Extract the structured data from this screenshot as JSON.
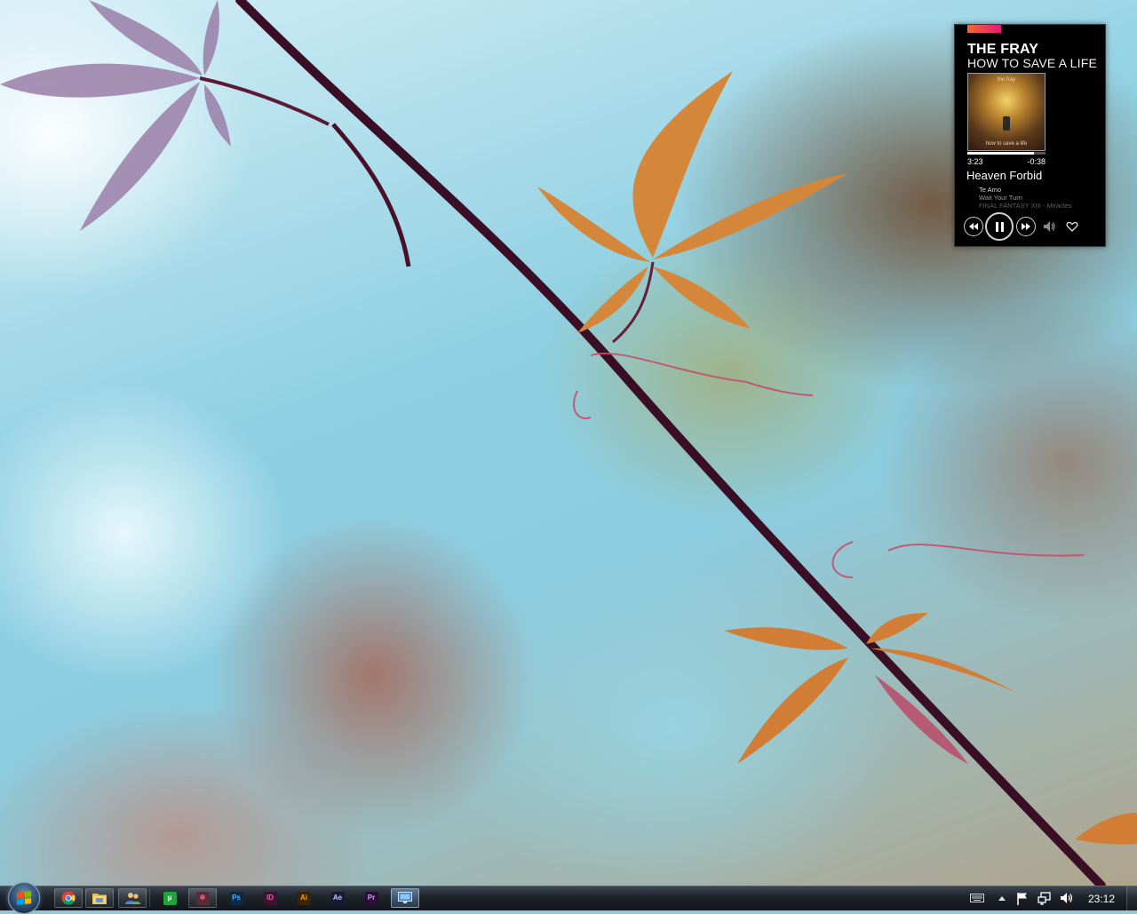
{
  "player": {
    "artist": "THE FRAY",
    "album": "HOW TO SAVE A LIFE",
    "cover_band_text": "the fray",
    "cover_title_text": "how to save a life",
    "progress_fraction": 0.85,
    "time_elapsed": "3:23",
    "time_remaining": "-0:38",
    "now_playing": "Heaven Forbid",
    "queue": [
      {
        "title": "Te Amo",
        "color": "#d8d8d8"
      },
      {
        "title": "Wait Your Turn",
        "color": "#9a9a9a"
      },
      {
        "title": "FINAL FANTASY XIII - Miracles",
        "color": "#5e5e5e"
      }
    ],
    "accent_gradient": [
      "#f2692a",
      "#e3197a"
    ],
    "controls": [
      "previous-icon",
      "pause-icon",
      "next-icon",
      "volume-icon",
      "heart-icon"
    ]
  },
  "taskbar": {
    "pinned": [
      {
        "name": "chrome",
        "icon": "chrome-icon"
      },
      {
        "name": "explorer",
        "icon": "folder-icon"
      },
      {
        "name": "users",
        "icon": "users-icon"
      },
      {
        "name": "utorrent",
        "icon": "utorrent-icon",
        "label": "µ",
        "bg": "#1fa33a",
        "fg": "#ffffff"
      },
      {
        "name": "app-pink",
        "icon": "pink-app-icon",
        "label": "✲",
        "bg": "#5a2a36",
        "fg": "#ff6a7e"
      },
      {
        "name": "photoshop",
        "icon": "photoshop-icon",
        "label": "Ps",
        "bg": "#0c2a45",
        "fg": "#4cb4ff"
      },
      {
        "name": "indesign",
        "icon": "indesign-icon",
        "label": "ID",
        "bg": "#3c1330",
        "fg": "#ff4fa8"
      },
      {
        "name": "illustrator",
        "icon": "illustrator-icon",
        "label": "Ai",
        "bg": "#3a2300",
        "fg": "#ffa200"
      },
      {
        "name": "after-effects",
        "icon": "after-effects-icon",
        "label": "Ae",
        "bg": "#1a1a36",
        "fg": "#c9c9ff"
      },
      {
        "name": "premiere",
        "icon": "premiere-icon",
        "label": "Pr",
        "bg": "#2a1036",
        "fg": "#d49cff"
      },
      {
        "name": "remote-desktop",
        "icon": "monitor-icon"
      }
    ],
    "tray": [
      "keyboard-icon",
      "show-hidden-icon",
      "flag-icon",
      "network-icon",
      "volume-icon"
    ],
    "clock": "23:12"
  }
}
